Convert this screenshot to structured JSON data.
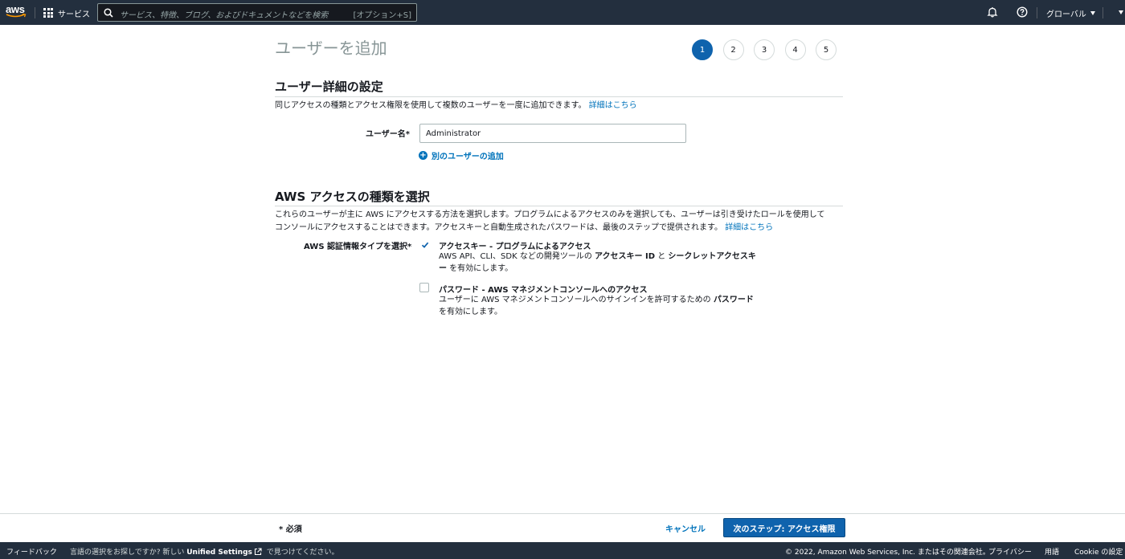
{
  "nav": {
    "logo_text": "aws",
    "services_label": "サービス",
    "search_placeholder": "サービス、特徴、ブログ、およびドキュメントなどを検索",
    "search_shortcut": "[オプション+S]",
    "region_label": "グローバル"
  },
  "page": {
    "title": "ユーザーを追加",
    "steps": [
      "1",
      "2",
      "3",
      "4",
      "5"
    ],
    "active_step": "1"
  },
  "details": {
    "section_title": "ユーザー詳細の設定",
    "description": "同じアクセスの種類とアクセス権限を使用して複数のユーザーを一度に追加できます。",
    "learn_more": "詳細はこちら",
    "username_label": "ユーザー名*",
    "username_value": "Administrator",
    "add_another_user": "別のユーザーの追加"
  },
  "access": {
    "section_title": "AWS アクセスの種類を選択",
    "description_line1": "これらのユーザーが主に AWS にアクセスする方法を選択します。プログラムによるアクセスのみを選択しても、ユーザーは引き受けたロールを使用して",
    "description_line2": "コンソールにアクセスすることはできます。アクセスキーと自動生成されたパスワードは、最後のステップで提供されます。",
    "learn_more": "詳細はこちら",
    "credential_type_label": "AWS 認証情報タイプを選択*",
    "options": [
      {
        "title": "アクセスキー - プログラムによるアクセス",
        "checked": true,
        "desc_pre": "AWS API、CLI、SDK などの開発ツールの ",
        "desc_bold1": "アクセスキー ID",
        "desc_mid": " と ",
        "desc_bold2": "シークレットアクセスキ",
        "desc_bold3": "ー",
        "desc_post": " を有効にします。"
      },
      {
        "title": "パスワード - AWS マネジメントコンソールへのアクセス",
        "checked": false,
        "desc_pre": "ユーザーに AWS マネジメントコンソールへのサインインを許可するための ",
        "desc_bold1": "パスワード",
        "desc_post": "を有効にします。"
      }
    ]
  },
  "action_bar": {
    "required_note": "* 必須",
    "cancel_label": "キャンセル",
    "next_label": "次のステップ: アクセス権限"
  },
  "footer": {
    "feedback": "フィードバック",
    "lang_pre": "言語の選択をお探しですか? 新しい ",
    "lang_bold": "Unified Settings",
    "lang_post": " で見つけてください。",
    "copyright": "© 2022, Amazon Web Services, Inc. またはその関連会社。",
    "privacy": "プライバシー",
    "terms": "用語",
    "cookie": "Cookie の設定"
  },
  "colors": {
    "nav_bg": "#232f3e",
    "primary": "#0f63ad",
    "link": "#0073bb"
  }
}
